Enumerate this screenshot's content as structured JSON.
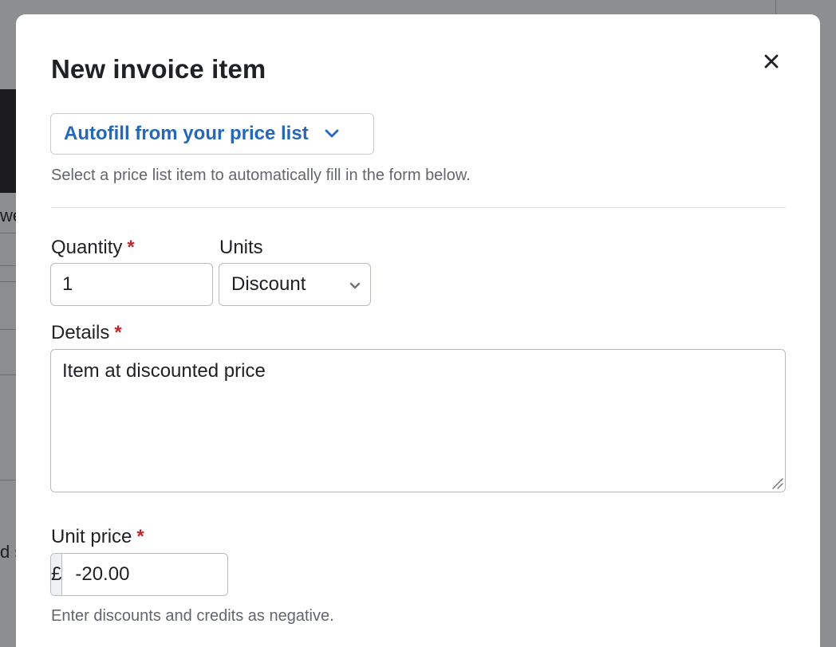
{
  "background": {
    "fragment_top": "we",
    "fragment_bottom": "d s"
  },
  "modal": {
    "title": "New invoice item",
    "close_icon": "close-icon",
    "autofill": {
      "label": "Autofill from your price list",
      "icon": "chevron-down-icon",
      "help": "Select a price list item to automatically fill in the form below."
    },
    "quantity": {
      "label": "Quantity",
      "required_mark": "*",
      "value": "1"
    },
    "units": {
      "label": "Units",
      "selected": "Discount",
      "icon": "chevron-down-icon"
    },
    "details": {
      "label": "Details",
      "required_mark": "*",
      "value": "Item at discounted price"
    },
    "unit_price": {
      "label": "Unit price",
      "required_mark": "*",
      "currency_symbol": "£",
      "value": "-20.00",
      "help": "Enter discounts and credits as negative."
    }
  },
  "colors": {
    "accent": "#2567b8",
    "required": "#c0272d",
    "overlay": "#8d8e90"
  }
}
